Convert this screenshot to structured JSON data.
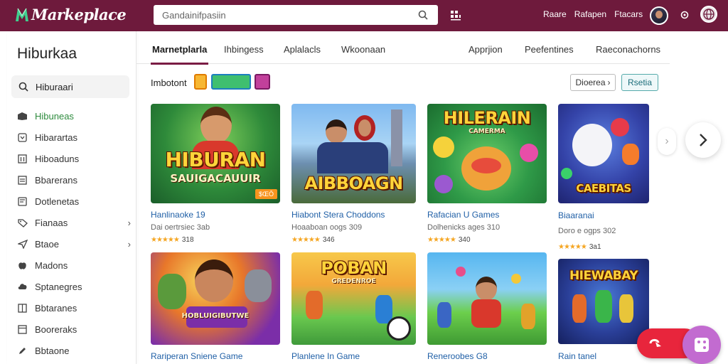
{
  "header": {
    "app_name": "Markeplace",
    "search_placeholder": "Gandainifpasiin",
    "links": [
      "Raare",
      "Rafapen",
      "Ftacars"
    ],
    "colors": {
      "bar": "#6e1a3c",
      "accent": "#7a1c44"
    }
  },
  "sidebar": {
    "title": "Hiburkaa",
    "search_label": "Hiburaari",
    "items": [
      {
        "label": "Hibuneas",
        "icon": "box-icon",
        "active": true
      },
      {
        "label": "Hibarartas",
        "icon": "chevron-box-icon"
      },
      {
        "label": "Hiboaduns",
        "icon": "grid-icon"
      },
      {
        "label": "Bbarerans",
        "icon": "list-icon"
      },
      {
        "label": "Dotlenetas",
        "icon": "doc-icon"
      },
      {
        "label": "Fianaas",
        "icon": "tag-icon",
        "chevron": true
      },
      {
        "label": "Btaoe",
        "icon": "send-icon",
        "chevron": true
      },
      {
        "label": "Madons",
        "icon": "apple-icon"
      },
      {
        "label": "Sptanegres",
        "icon": "cloud-icon"
      },
      {
        "label": "Bbtaranes",
        "icon": "book-icon"
      },
      {
        "label": "Booreraks",
        "icon": "window-icon"
      },
      {
        "label": "Bbtaone",
        "icon": "pen-icon"
      }
    ]
  },
  "tabs": [
    {
      "label": "Marnetplarla",
      "active": true
    },
    {
      "label": "Ihbingess"
    },
    {
      "label": "Aplalacls"
    },
    {
      "label": "Wkoonaan"
    },
    {
      "label": "Apprjion"
    },
    {
      "label": "Peefentines"
    },
    {
      "label": "Raeconachorns"
    }
  ],
  "filter": {
    "label": "Imbotont",
    "sort_label": "Dioerea",
    "sort_icon": "chevron-icon",
    "filter_label": "Rsetia"
  },
  "cards_row1": [
    {
      "thumb_title": "HIBURAN",
      "thumb_sub": "SAUIGACAUUIR",
      "price": "$ŒŌ",
      "name": "Hanlinaoke 19",
      "meta": "Dai oertrsiec 3ab",
      "rating": "318"
    },
    {
      "thumb_title": "AIBBOAGN",
      "thumb_sub": "",
      "name": "Hiabont Stera Choddons",
      "meta": "Hoaaboan oogs 309",
      "rating": "346"
    },
    {
      "thumb_title": "HILERAIN",
      "thumb_sub": "CAMERMA",
      "name": "Rafacian U Games",
      "meta": "Dolhenicks ages 310",
      "rating": "340"
    },
    {
      "thumb_title": "CAEBITAS",
      "thumb_sub": "",
      "name": "Biaaranai",
      "meta": "Doro e ogps 302",
      "rating": "3a1"
    }
  ],
  "cards_row2": [
    {
      "thumb_title": "",
      "thumb_sub": "HOBLUIGIBUTWE",
      "name": "Rariperan Sniene Game"
    },
    {
      "thumb_title": "POBAN",
      "thumb_sub": "GREDENROE",
      "name": "Planlene In Game"
    },
    {
      "thumb_title": "",
      "thumb_sub": "",
      "name": "Reneroobes G8"
    },
    {
      "thumb_title": "HIEWABAY",
      "thumb_sub": "",
      "name": "Rain tanel"
    }
  ]
}
